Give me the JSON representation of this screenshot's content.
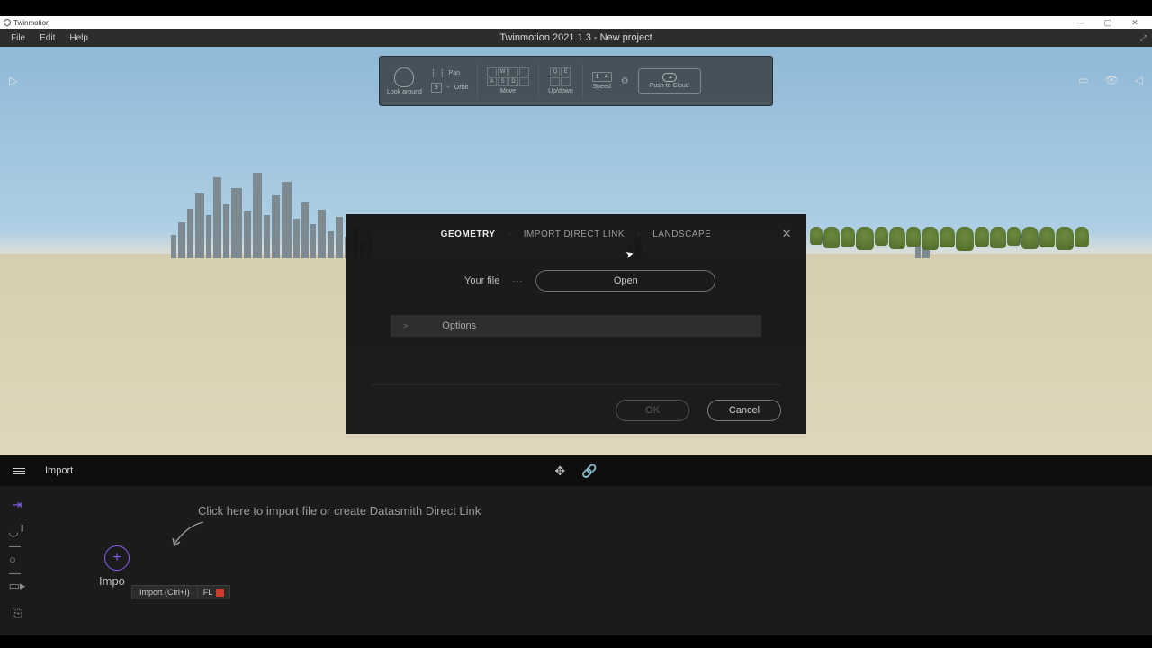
{
  "os": {
    "app_name": "Twinmotion",
    "win_min": "—",
    "win_max": "▢",
    "win_close": "✕"
  },
  "menubar": {
    "file": "File",
    "edit": "Edit",
    "help": "Help",
    "title": "Twinmotion 2021.1.3 - New project",
    "expand_icon": "⤢"
  },
  "hud": {
    "look_label": "Look around",
    "pan": "Pan",
    "orbit": "Orbit",
    "orbit_key": "9",
    "move_label": "Move",
    "move_keys_top": [
      "",
      "W",
      "",
      ""
    ],
    "move_keys_bot": [
      "A",
      "S",
      "D",
      ""
    ],
    "updown_label": "Up/down",
    "updown_keys_top": [
      "Q",
      "E"
    ],
    "updown_keys_bot": [
      "",
      ""
    ],
    "speed_label": "Speed",
    "speed_val": "1 - 4",
    "gear": "⚙",
    "cloud_label": "Push to Cloud"
  },
  "topright": {
    "aspect": "▭",
    "eye": "👁",
    "panel": "◁"
  },
  "dialog": {
    "tab_geometry": "GEOMETRY",
    "tab_directlink": "IMPORT DIRECT LINK",
    "tab_landscape": "LANDSCAPE",
    "sep": "·",
    "close": "✕",
    "your_file": "Your file",
    "dots": "···",
    "open": "Open",
    "options_chev": ">",
    "options": "Options",
    "ok": "OK",
    "cancel": "Cancel"
  },
  "dockbar": {
    "breadcrumb": "Import",
    "move_icon": "✥",
    "link_icon": "🔗"
  },
  "lower": {
    "hint": "Click here to import file or create Datasmith Direct Link",
    "import_trunc": "Impo",
    "tooltip_text": "Import (Ctrl+I)",
    "tooltip_key": "FL"
  },
  "sidetools": {
    "t0": "⇥",
    "t1": "◡╹",
    "t2": "—○—",
    "t3": "▭▸",
    "t4": "⎘"
  },
  "viewport": {
    "play": "▷"
  }
}
